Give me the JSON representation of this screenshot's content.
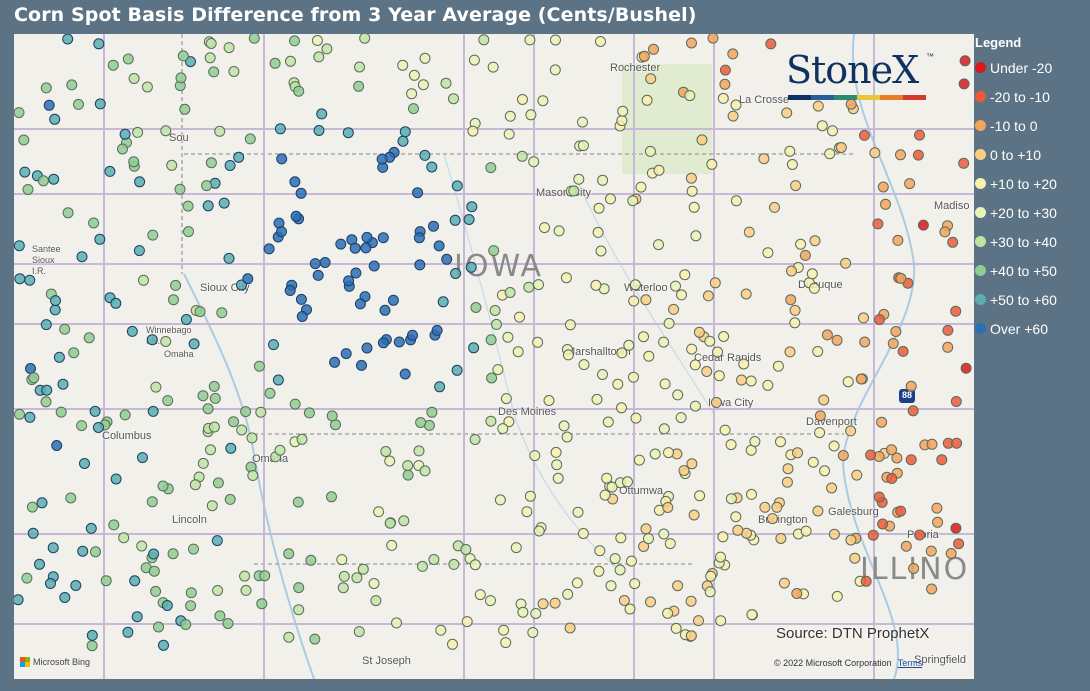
{
  "title": "Corn Spot Basis Difference from 3 Year Average (Cents/Bushel)",
  "legend": {
    "title": "Legend",
    "items": [
      {
        "label": "Under -20",
        "color": "#d7191c"
      },
      {
        "label": "-20 to -10",
        "color": "#ec5a3a"
      },
      {
        "label": "-10 to 0",
        "color": "#f5a45e"
      },
      {
        "label": "0 to +10",
        "color": "#fbcd85"
      },
      {
        "label": "+10 to +20",
        "color": "#f8f0b0"
      },
      {
        "label": "+20 to +30",
        "color": "#e7f3b8"
      },
      {
        "label": "+30 to +40",
        "color": "#c0e4a6"
      },
      {
        "label": "+40 to +50",
        "color": "#8fcd92"
      },
      {
        "label": "+50 to +60",
        "color": "#5aaeb0"
      },
      {
        "label": "Over +60",
        "color": "#2b6fb5"
      }
    ]
  },
  "map": {
    "state_labels": {
      "iowa": "IOWA",
      "illinois": "ILLINO"
    },
    "places": {
      "rochester": "Rochester",
      "la_crosse": "La Crosse",
      "sioux_falls": "Sou",
      "mason_city": "Mason City",
      "santee": "Santee\nSioux\nI.R.",
      "sioux_city": "Sioux City",
      "waterloo": "Waterloo",
      "dubuque": "Dubuque",
      "madison": "Madiso",
      "winnebago": "Winnebago\nI.R.",
      "omaha_ir": "Omaha",
      "marshalltown": "Marshalltown",
      "cedar_rapids": "Cedar Rapids",
      "columbus": "Columbus",
      "des_moines": "Des Moines",
      "iowa_city": "Iowa City",
      "davenport": "Davenport",
      "omaha": "Omaha",
      "lincoln": "Lincoln",
      "ottumwa": "Ottumwa",
      "burlington": "Burlington",
      "galesburg": "Galesburg",
      "peoria": "Peoria",
      "st_joseph": "St Joseph",
      "springfield": "Springfield",
      "interstate": "88"
    },
    "attribution": {
      "source": "Source: DTN ProphetX",
      "ms_bing": "Microsoft Bing",
      "copyright": "© 2022 Microsoft Corporation",
      "terms": "Terms"
    }
  },
  "logo": {
    "text": "StoneX",
    "tm": "™",
    "bar_colors": [
      "#0f3262",
      "#2a5d9e",
      "#2e8a6e",
      "#e8c640",
      "#e87c28",
      "#d23c2c"
    ]
  }
}
